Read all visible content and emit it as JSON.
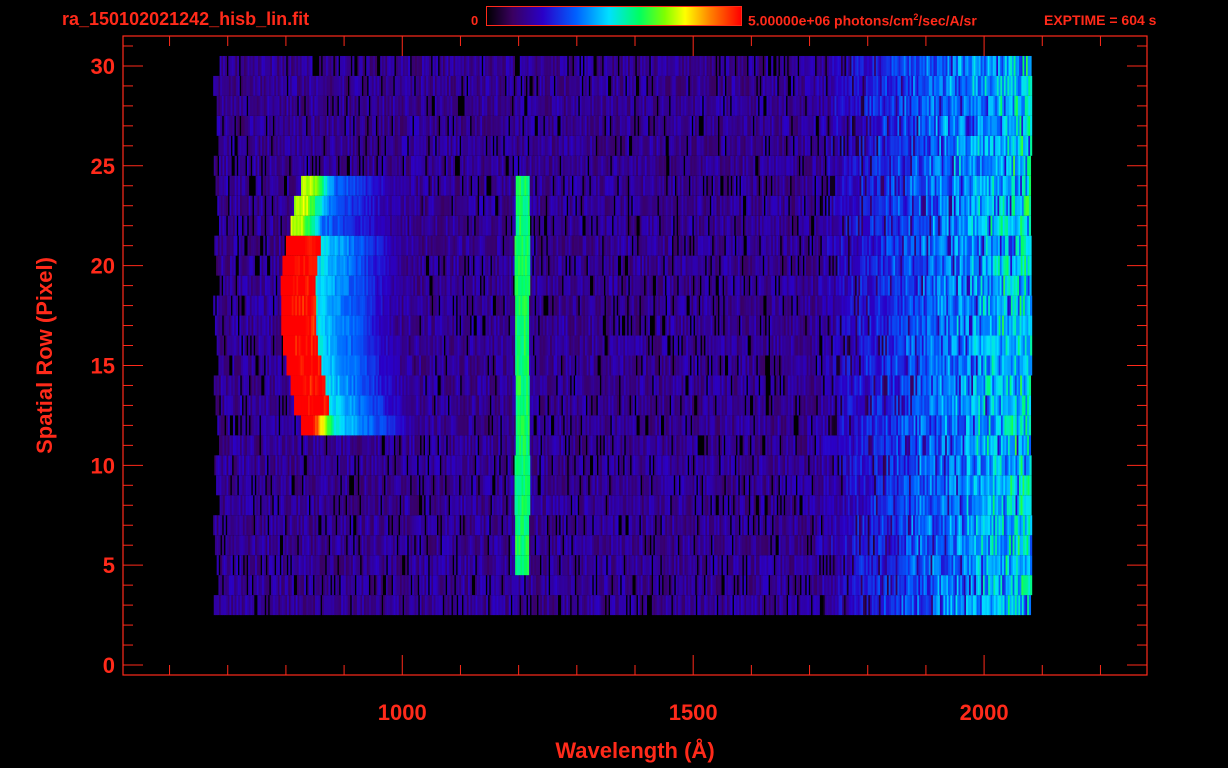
{
  "header": {
    "filename": "ra_150102021242_hisb_lin.fit",
    "colorbar_min": "0",
    "colorbar_max_value": "5.00000e+06 photons/cm",
    "colorbar_max_sup": "2",
    "colorbar_max_rest": "/sec/A/sr",
    "exptime": "EXPTIME = 604 s"
  },
  "colors": {
    "axis": "#ff2a1a",
    "background": "#000000"
  },
  "chart_data": {
    "type": "heatmap",
    "xlabel": "Wavelength (Å)",
    "ylabel": "Spatial Row (Pixel)",
    "xlim": [
      520,
      2280
    ],
    "ylim": [
      -0.5,
      31.5
    ],
    "x_ticks": [
      1000,
      1500,
      2000
    ],
    "y_ticks": [
      0,
      5,
      10,
      15,
      20,
      25,
      30
    ],
    "colorbar_range": [
      0,
      5000000
    ],
    "colormap": "rainbow",
    "rows": [
      3,
      30
    ],
    "wavelength_range": [
      685,
      2080
    ],
    "features": [
      {
        "name": "arc emission",
        "x_range": [
          780,
          1030
        ],
        "rows": [
          12,
          24
        ],
        "peak_x": 810,
        "peak_rows": [
          13,
          21
        ],
        "level": 1.0
      },
      {
        "name": "line emission",
        "x_center": 1205,
        "width": 25,
        "rows": [
          5,
          24
        ],
        "level": 0.55
      },
      {
        "name": "long-wavelength continuum",
        "x_range": [
          1700,
          2060
        ],
        "rows": [
          3,
          30
        ],
        "level": 0.45
      }
    ],
    "grid": false
  }
}
